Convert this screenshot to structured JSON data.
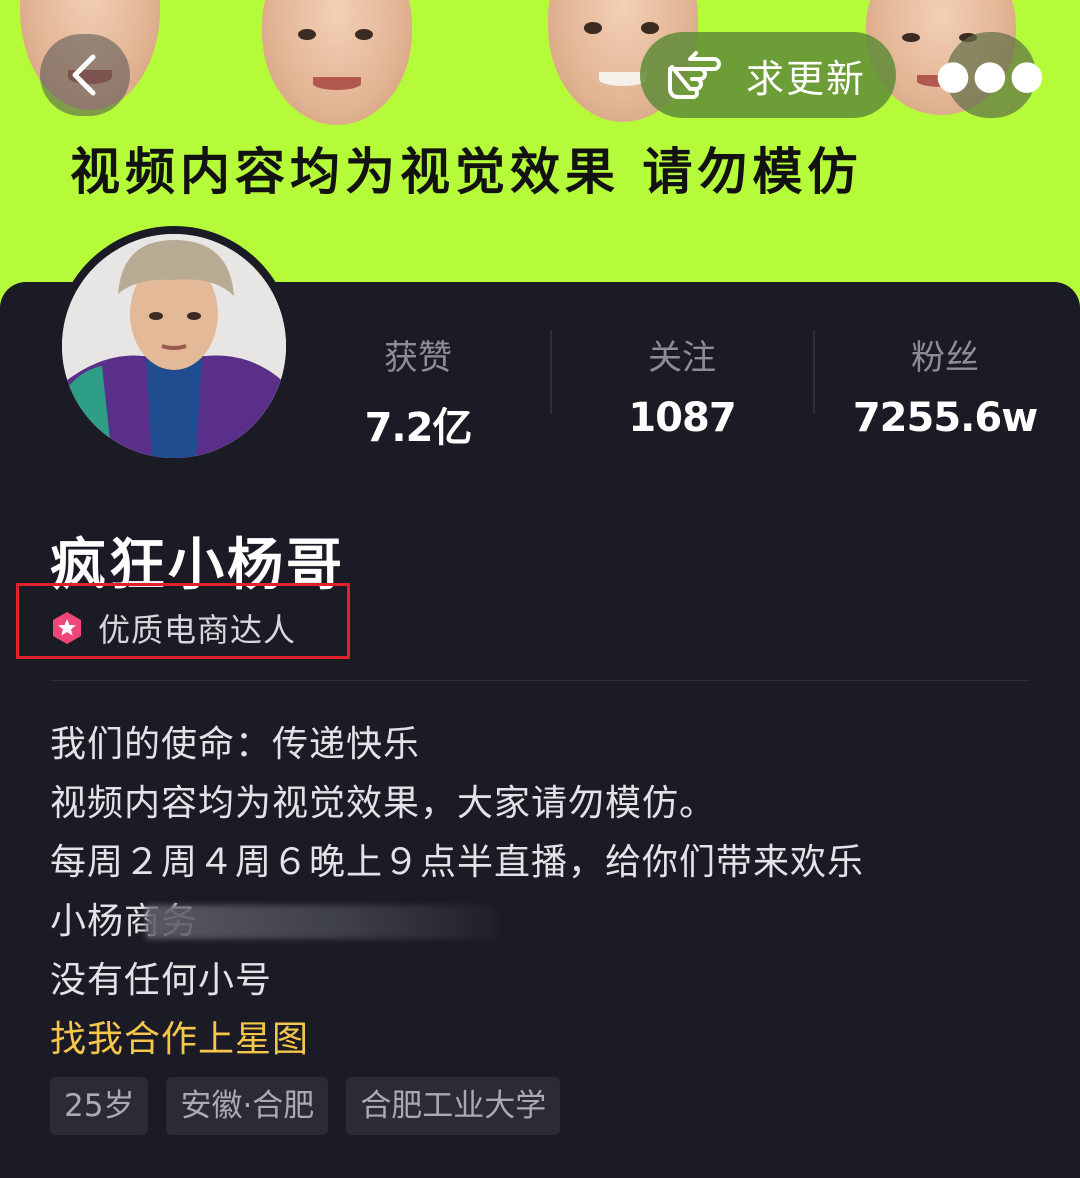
{
  "header": {
    "banner_caption": "视频内容均为视觉效果  请勿模仿",
    "update_button_label": "求更新",
    "banner_color": "#b6fb3a"
  },
  "icons": {
    "back": "chevron-left-icon",
    "update": "pointing-hand-icon",
    "more": "more-icon",
    "badge": "star-badge-icon"
  },
  "stats": [
    {
      "label": "获赞",
      "value": "7.2亿"
    },
    {
      "label": "关注",
      "value": "1087"
    },
    {
      "label": "粉丝",
      "value": "7255.6w"
    }
  ],
  "profile": {
    "name": "疯狂小杨哥",
    "badge_label": "优质电商达人",
    "badge_color": "#f0467a",
    "highlight_box_color": "#e2222b"
  },
  "bio": {
    "lines": [
      "我们的使命：传递快乐",
      "视频内容均为视觉效果，大家请勿模仿。",
      "每周２周４周６晚上９点半直播，给你们带来欢乐",
      "小杨商务",
      "没有任何小号"
    ],
    "link_text": "找我合作上星图",
    "link_color": "#f6c64a"
  },
  "tags": [
    "25岁",
    "安徽·合肥",
    "合肥工业大学"
  ]
}
